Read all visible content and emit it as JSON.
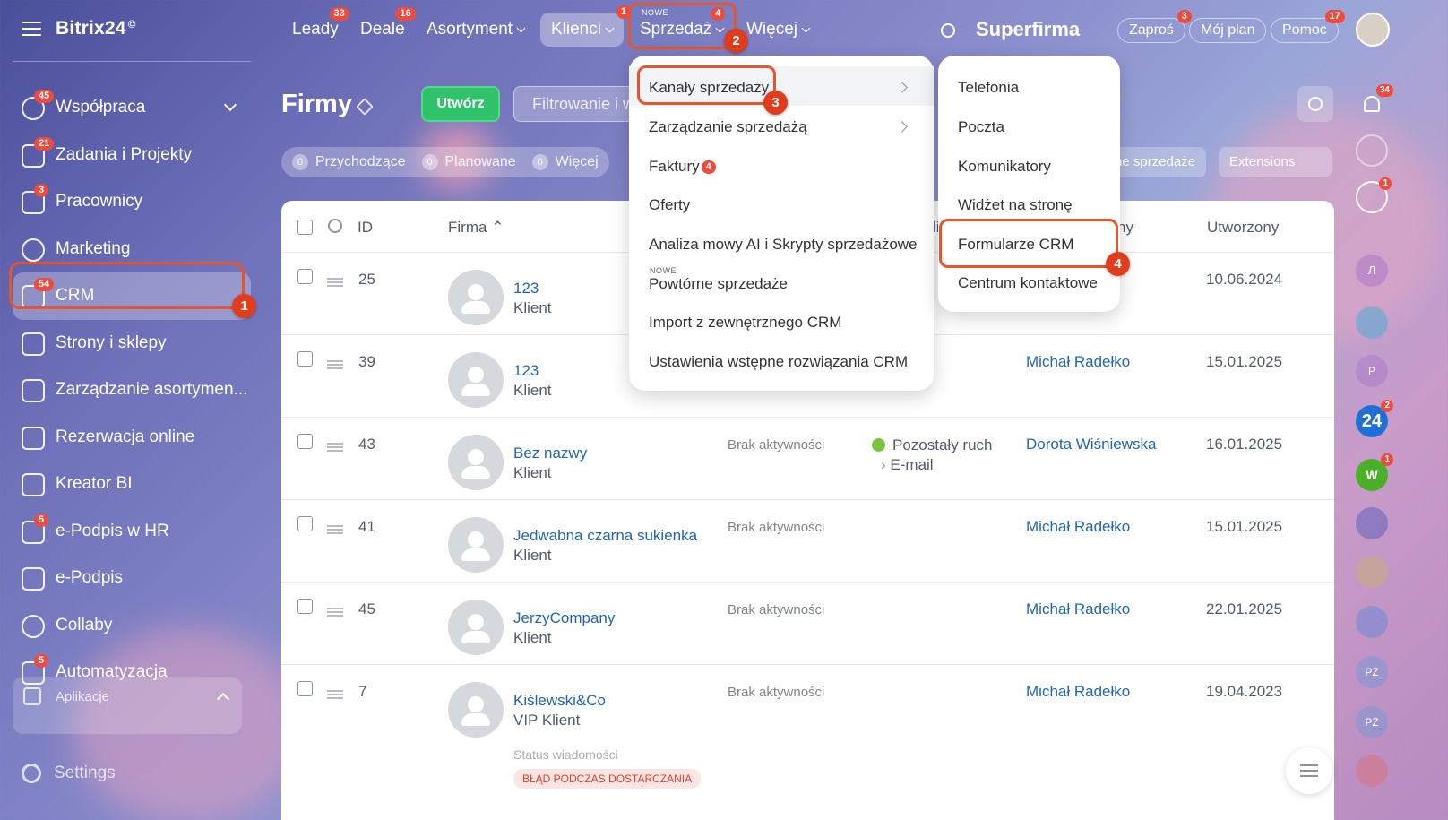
{
  "app": {
    "logo": "Bitrix24",
    "logo_mark": "©"
  },
  "sidebar": {
    "items": [
      {
        "label": "Współpraca",
        "count": "45"
      },
      {
        "label": "Zadania i Projekty",
        "count": "21"
      },
      {
        "label": "Pracownicy",
        "count": "3"
      },
      {
        "label": "Marketing",
        "count": ""
      },
      {
        "label": "CRM",
        "count": "54"
      },
      {
        "label": "Strony i sklepy",
        "count": ""
      },
      {
        "label": "Zarządzanie asortymen...",
        "count": ""
      },
      {
        "label": "Rezerwacja online",
        "count": ""
      },
      {
        "label": "Kreator BI",
        "count": ""
      },
      {
        "label": "e-Podpis w HR",
        "count": "5"
      },
      {
        "label": "e-Podpis",
        "count": ""
      },
      {
        "label": "Collaby",
        "count": ""
      },
      {
        "label": "Automatyzacja",
        "count": "5"
      }
    ],
    "apps_label": "Aplikacje",
    "settings_label": "Settings"
  },
  "topbar": {
    "tabs": [
      {
        "label": "Leady",
        "count": "33"
      },
      {
        "label": "Deale",
        "count": "16"
      },
      {
        "label": "Asortyment",
        "count": ""
      },
      {
        "label": "Klienci",
        "count": "1"
      },
      {
        "label": "Sprzedaż",
        "count": "4",
        "tag": "NOWE"
      },
      {
        "label": "Więcej",
        "count": ""
      }
    ],
    "company": "Superfirma",
    "invite": {
      "label": "Zaproś",
      "count": "3"
    },
    "myplan": "Mój plan",
    "help": {
      "label": "Pomoc",
      "count": "17"
    }
  },
  "page": {
    "title": "Firmy",
    "create_button": "Utwórz",
    "filter_placeholder": "Filtrowanie i wyszukiwanie",
    "counters": [
      {
        "num": "0",
        "label": "Przychodzące"
      },
      {
        "num": "0",
        "label": "Planowane"
      },
      {
        "num": "0",
        "label": "Więcej"
      }
    ],
    "pill_sales": "ne sprzedaże",
    "pill_ext": "Extensions"
  },
  "grid": {
    "headers": {
      "id": "ID",
      "firma": "Firma",
      "col_li": "li",
      "col_ny": "ny",
      "created": "Utworzony"
    },
    "rows": [
      {
        "id": "25",
        "name": "123",
        "type": "Klient",
        "activity": "",
        "resp": "",
        "date": "10.06.2024"
      },
      {
        "id": "39",
        "name": "123",
        "type": "Klient",
        "activity": "",
        "resp": "Michał Radełko",
        "date": "15.01.2025"
      },
      {
        "id": "43",
        "name": "Bez nazwy",
        "type": "Klient",
        "activity": "Brak aktywności",
        "resp": "Dorota Wiśniewska",
        "date": "16.01.2025"
      },
      {
        "id": "41",
        "name": "Jedwabna czarna sukienka",
        "type": "Klient",
        "activity": "Brak aktywności",
        "resp": "Michał Radełko",
        "date": "15.01.2025"
      },
      {
        "id": "45",
        "name": "JerzyCompany",
        "type": "Klient",
        "activity": "Brak aktywności",
        "resp": "Michał Radełko",
        "date": "22.01.2025"
      },
      {
        "id": "7",
        "name": "Kiślewski&Co",
        "type": "VIP Klient",
        "activity": "Brak aktywności",
        "resp": "Michał Radełko",
        "date": "19.04.2023"
      }
    ],
    "row1_resp_tail": "o",
    "source_line1": "Pozostały ruch",
    "source_line2": "E-mail",
    "status_label": "Status wiadomości",
    "status_badge": "BŁĄD PODCZAS DOSTARCZANIA"
  },
  "menu_sales": {
    "items": [
      "Kanały sprzedaży",
      "Zarządzanie sprzedażą",
      "Faktury",
      "Oferty",
      "Analiza mowy AI i Skrypty sprzedażowe",
      "Powtórne sprzedaże",
      "Import z zewnętrznego CRM",
      "Ustawienia wstępne rozwiązania CRM"
    ],
    "faktury_count": "4",
    "nowe_tag": "NOWE"
  },
  "menu_channels": {
    "items": [
      "Telefonia",
      "Poczta",
      "Komunikatory",
      "Widżet na stronę",
      "Formularze CRM",
      "Centrum kontaktowe"
    ]
  },
  "steps": [
    "1",
    "2",
    "3",
    "4"
  ],
  "rail": {
    "notif_count": "34",
    "c1": "1",
    "c2": "2",
    "c3": "1",
    "b24": "24",
    "w": "W",
    "p": "P",
    "pz": "PZ",
    "pz2": "PZ",
    "ll": "Л"
  },
  "colors": {
    "accent_outline": "#e8542b",
    "step_badge": "#e23c1e",
    "counter": "#ef4a3c",
    "create_btn": "#2fc26b",
    "link": "#2067b0"
  }
}
